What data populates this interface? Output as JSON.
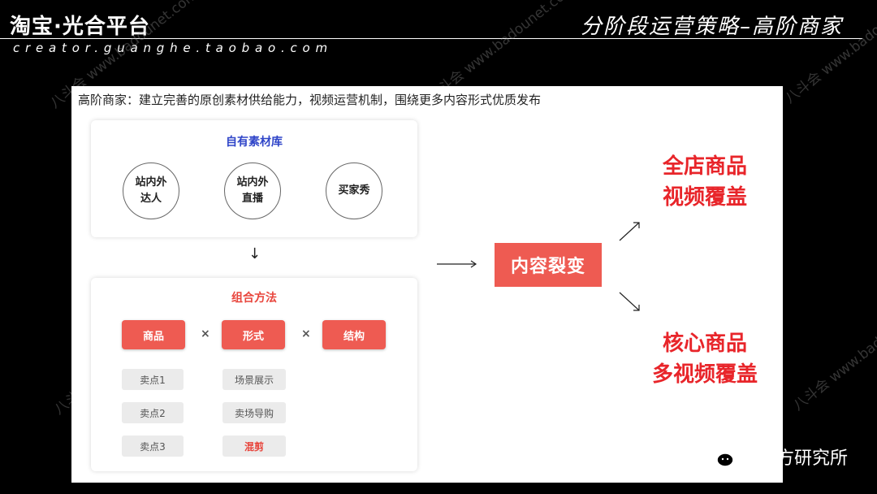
{
  "header": {
    "brand": "淘宝·光合平台",
    "site": "creator.guanghe.taobao.com",
    "slide_title": "分阶段运营策略–高阶商家"
  },
  "watermark": "八斗会 www.badounet.com",
  "main": {
    "subtitle": "高阶商家：建立完善的原创素材供给能力，视频运营机制，围绕更多内容形式优质发布",
    "library": {
      "title": "自有素材库",
      "circles": [
        "站内外\n达人",
        "站内外\n直播",
        "买家秀"
      ]
    },
    "down_arrow": "↓",
    "method": {
      "title": "组合方法",
      "factors": [
        "商品",
        "形式",
        "结构"
      ],
      "times": "×",
      "columns": [
        [
          "卖点1",
          "卖点2",
          "卖点3"
        ],
        [
          "场景展示",
          "卖场导购",
          "混剪"
        ]
      ]
    },
    "core": "内容裂变",
    "results": [
      {
        "line1": "全店商品",
        "line2": "视频覆盖"
      },
      {
        "line1": "核心商品",
        "line2": "多视频覆盖"
      }
    ]
  },
  "footer": {
    "wechat": "品牌方研究所"
  }
}
